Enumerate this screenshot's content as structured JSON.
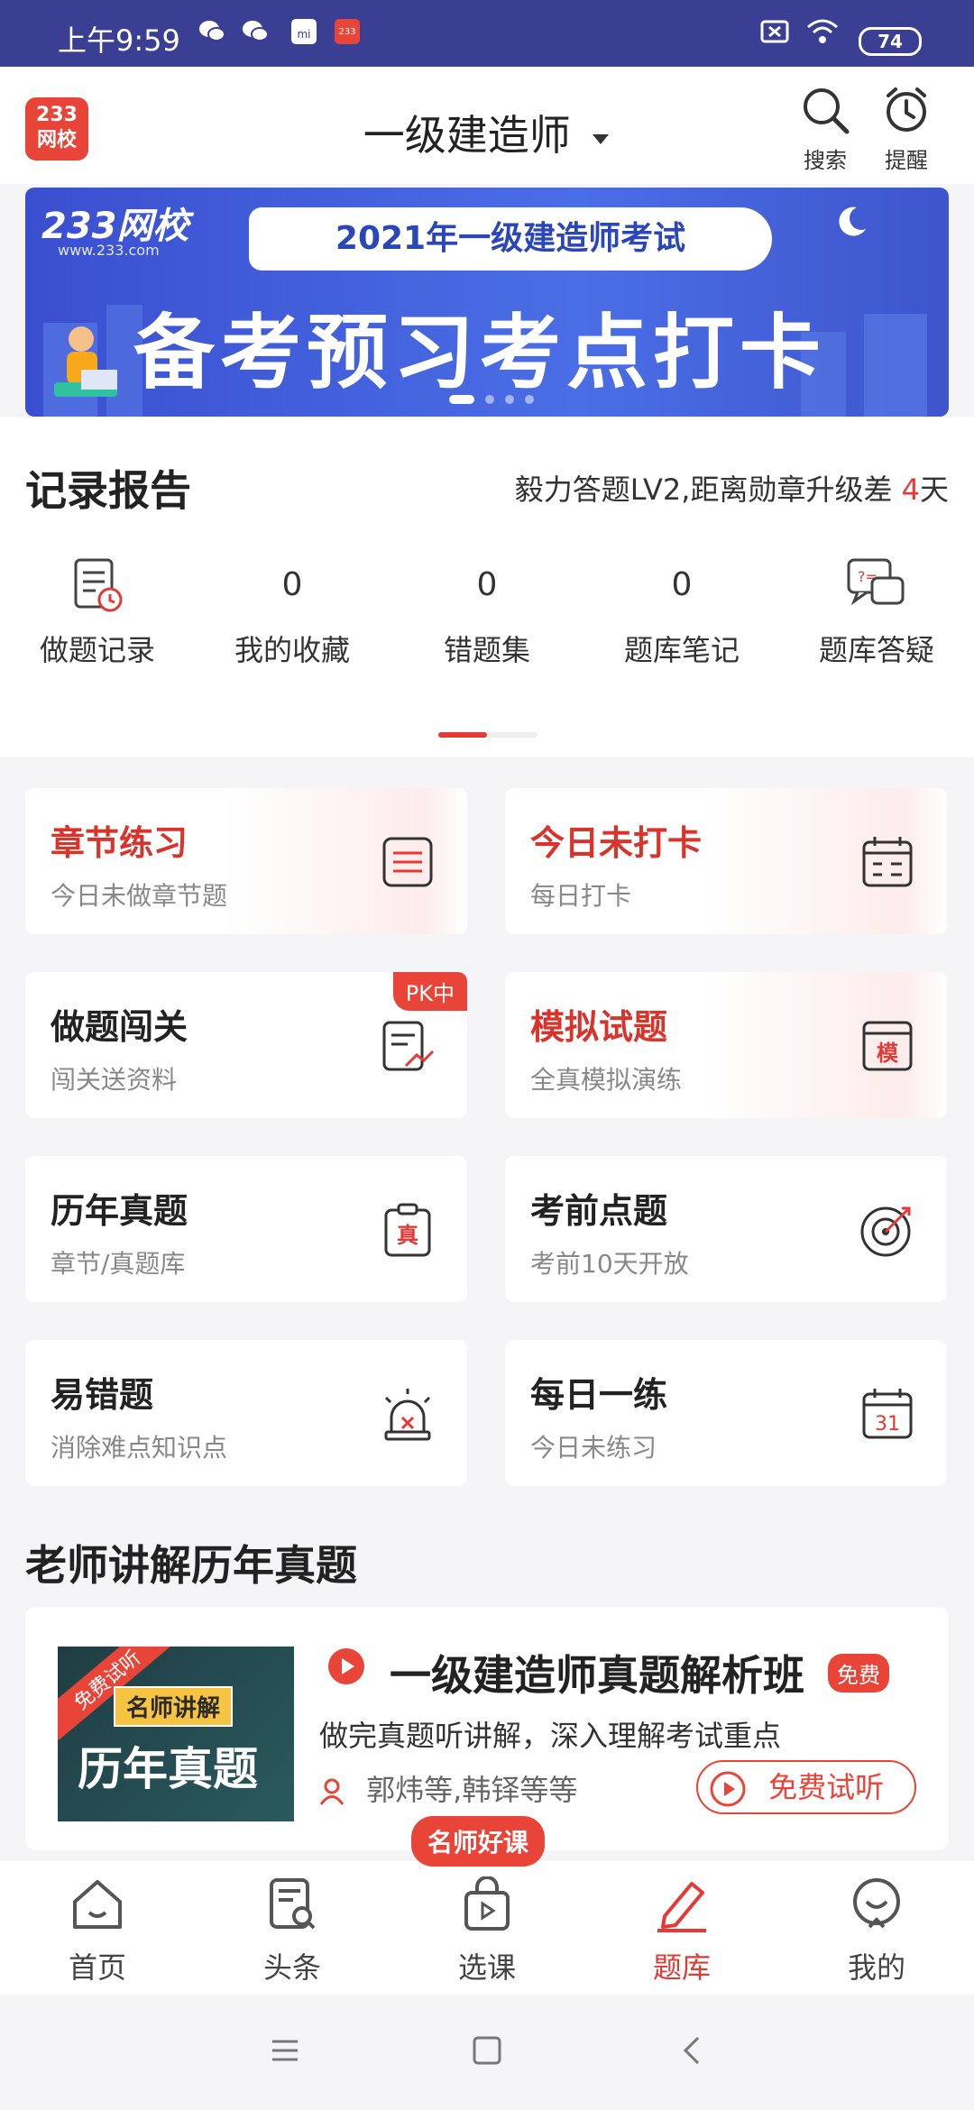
{
  "status_bar": {
    "time": "上午9:59",
    "battery": "74"
  },
  "header": {
    "logo_line1": "233",
    "logo_line2": "网校",
    "exam_title": "一级建造师",
    "search_label": "搜索",
    "remind_label": "提醒"
  },
  "banner": {
    "brand": "233网校",
    "brand_url": "www.233.com",
    "headline": "2021年一级建造师考试",
    "slogan": "备考预习考点打卡"
  },
  "records": {
    "title": "记录报告",
    "level_text": "毅力答题LV2,距离勋章升级差 ",
    "level_days": "4",
    "level_unit": "天",
    "items": [
      {
        "label": "做题记录",
        "value": ""
      },
      {
        "label": "我的收藏",
        "value": "0"
      },
      {
        "label": "错题集",
        "value": "0"
      },
      {
        "label": "题库笔记",
        "value": "0"
      },
      {
        "label": "题库答疑",
        "value": ""
      }
    ]
  },
  "practice_cards": [
    {
      "title": "章节练习",
      "subtitle": "今日未做章节题",
      "icon": "list-icon"
    },
    {
      "title": "今日未打卡",
      "subtitle": "每日打卡",
      "icon": "calendar-icon"
    },
    {
      "title": "做题闯关",
      "subtitle": "闯关送资料",
      "icon": "chart-doc-icon",
      "badge": "PK中"
    },
    {
      "title": "模拟试题",
      "subtitle": "全真模拟演练",
      "icon": "mock-exam-icon",
      "icon_text": "模"
    },
    {
      "title": "历年真题",
      "subtitle": "章节/真题库",
      "icon": "clipboard-icon",
      "icon_text": "真"
    },
    {
      "title": "考前点题",
      "subtitle": "考前10天开放",
      "icon": "target-icon"
    },
    {
      "title": "易错题",
      "subtitle": "消除难点知识点",
      "icon": "alarm-icon"
    },
    {
      "title": "每日一练",
      "subtitle": "今日未练习",
      "icon": "daily-calendar-icon",
      "icon_text": "31"
    }
  ],
  "teacher_section": {
    "title": "老师讲解历年真题",
    "course": {
      "thumb_corner": "免费试听",
      "thumb_tag": "名师讲解",
      "thumb_big": "历年真题",
      "title": "一级建造师真题解析班",
      "badge": "免费",
      "description": "做完真题听讲解，深入理解考试重点",
      "teachers": "郭炜等,韩铎等等",
      "trial_button": "免费试听"
    }
  },
  "promo_bubble": "名师好课",
  "bottom_nav": [
    {
      "label": "首页",
      "icon": "home-icon"
    },
    {
      "label": "头条",
      "icon": "news-icon"
    },
    {
      "label": "选课",
      "icon": "course-bag-icon"
    },
    {
      "label": "题库",
      "icon": "pen-icon",
      "active": true
    },
    {
      "label": "我的",
      "icon": "profile-icon"
    }
  ],
  "colors": {
    "accent": "#e53935",
    "status_bar": "#3a3f93",
    "banner": "#4a6ee6"
  }
}
